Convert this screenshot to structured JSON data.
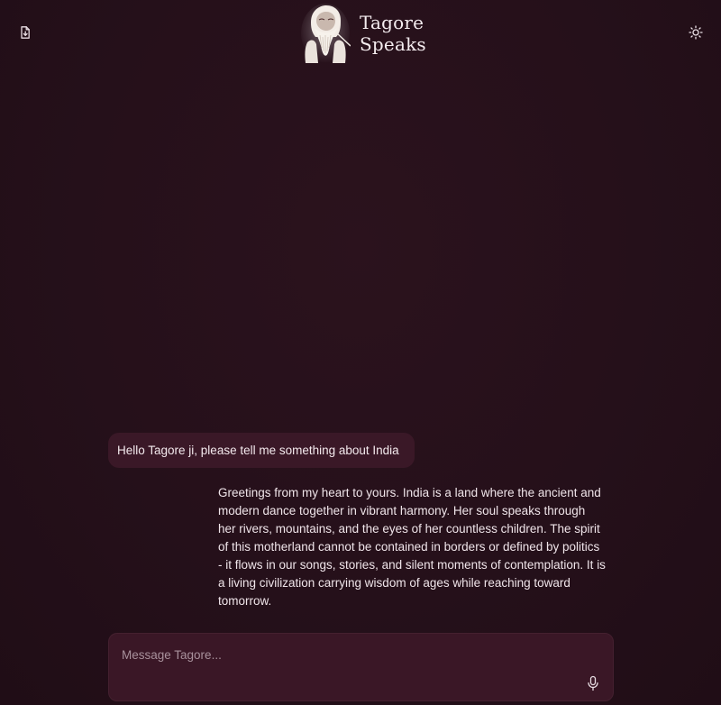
{
  "header": {
    "brand_line1": "Tagore",
    "brand_line2": "Speaks",
    "export_icon": "file-export-icon",
    "theme_icon": "sun-icon"
  },
  "conversation": {
    "user_message": "Hello Tagore ji, please tell me something about India",
    "assistant_message": "Greetings from my heart to yours. India is a land where the ancient and modern dance together in vibrant harmony. Her soul speaks through her rivers, mountains, and the eyes of her countless children. The spirit of this motherland cannot be contained in borders or defined by politics - it flows in our songs, stories, and silent moments of contemplation. It is a living civilization carrying wisdom of ages while reaching toward tomorrow."
  },
  "composer": {
    "placeholder": "Message Tagore...",
    "value": "",
    "mic_icon": "microphone-icon"
  },
  "colors": {
    "background": "#251019",
    "user_bubble": "#3a1827",
    "composer": "#3a1726",
    "text": "#f2e8ec"
  }
}
